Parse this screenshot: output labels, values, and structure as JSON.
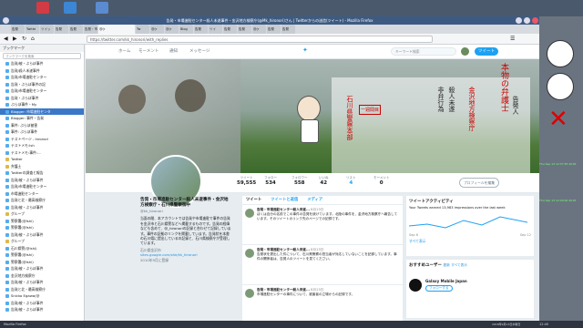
{
  "window": {
    "title": "告発・市場進駐センター殺人未遂事件・金沢地方検察庁(@Mk_hironori)さん | Twitterからの送信(ツイート) - Mozilla Firefox"
  },
  "tabs": [
    "告発",
    "Twitte",
    "ツイッ",
    "告発",
    "告発",
    "告発・市場進駐",
    "@(r",
    "Tw",
    "@(r",
    "@(r",
    "Blog",
    "告発",
    "ツイ",
    "告発",
    "告発",
    "@(r",
    "告発",
    "告発"
  ],
  "url": "https://twitter.com/kk_hironori/with_replies",
  "sidebar": {
    "title": "ブックマーク",
    "search_placeholder": "ブックマークを検索",
    "items": [
      {
        "label": "告発/被・ぶらぼ事件",
        "type": "link",
        "sel": false
      },
      {
        "label": "告発/殺人未遂事件",
        "type": "link",
        "sel": false
      },
      {
        "label": "告発/市場進駐センター",
        "type": "link",
        "sel": false
      },
      {
        "label": "告発・ぶらぼ事件の記",
        "type": "link",
        "sel": false
      },
      {
        "label": "告発/市場進駐センター",
        "type": "link",
        "sel": false
      },
      {
        "label": "告発・ぶらぼ事件",
        "type": "link",
        "sel": false
      },
      {
        "label": "ぶらぼ事件・My",
        "type": "link",
        "sel": false
      },
      {
        "label": "Blogger: 市場進駐センタ",
        "type": "link",
        "sel": true
      },
      {
        "label": "Blogger: 事件・告発",
        "type": "link",
        "sel": false
      },
      {
        "label": "事件: ぶらぼ被害",
        "type": "link",
        "sel": false
      },
      {
        "label": "事件: ぶらぼ事件",
        "type": "link",
        "sel": false
      },
      {
        "label": "テストページ - hironori",
        "type": "link",
        "sel": false
      },
      {
        "label": "テストメモ:Ish",
        "type": "link",
        "sel": false
      },
      {
        "label": "テストメモ:事件:...",
        "type": "link",
        "sel": false
      },
      {
        "label": "Twitter",
        "type": "folder",
        "sel": false
      },
      {
        "label": "弁護士",
        "type": "folder",
        "sel": false
      },
      {
        "label": "Twitterの調査と報告",
        "type": "link",
        "sel": false
      },
      {
        "label": "告発/被・ぶらぼ事件",
        "type": "link",
        "sel": false
      },
      {
        "label": "告発/市場進駐センター",
        "type": "link",
        "sel": false
      },
      {
        "label": "市場進駐センター",
        "type": "link",
        "sel": false
      },
      {
        "label": "告発と北・最高検察庁",
        "type": "link",
        "sel": false
      },
      {
        "label": "告発/被・ぶらぼ事件",
        "type": "link",
        "sel": false
      },
      {
        "label": "グループ",
        "type": "folder",
        "sel": false
      },
      {
        "label": "警察署(@Ishi)",
        "type": "link",
        "sel": false
      },
      {
        "label": "警察署(@Ishi)",
        "type": "link",
        "sel": false
      },
      {
        "label": "告発/被・ぶらぼ事件",
        "type": "link",
        "sel": false
      },
      {
        "label": "グループ",
        "type": "folder",
        "sel": false
      },
      {
        "label": "石川県警(@Ishi)",
        "type": "link",
        "sel": false
      },
      {
        "label": "警察署(@Ishi)",
        "type": "link",
        "sel": false
      },
      {
        "label": "警察署(@Ishi)",
        "type": "link",
        "sel": false
      },
      {
        "label": "告発/被・ぶらぼ事件",
        "type": "link",
        "sel": false
      },
      {
        "label": "金沢地方検察庁",
        "type": "link",
        "sel": false
      },
      {
        "label": "告発/被・ぶらぼ事件",
        "type": "link",
        "sel": false
      },
      {
        "label": "告発と北・最高検察庁",
        "type": "link",
        "sel": false
      },
      {
        "label": "Snicko Egawa(@",
        "type": "link",
        "sel": false
      },
      {
        "label": "告発/被・ぶらぼ事件",
        "type": "link",
        "sel": false
      },
      {
        "label": "告発/被・ぶらぼ事件",
        "type": "link",
        "sel": false
      }
    ]
  },
  "twitter_nav": {
    "home": "ホーム",
    "moments": "モーメント",
    "notifications": "通知",
    "messages": "メッセージ",
    "search_placeholder": "キーワード検索",
    "tweet_button": "ツイート"
  },
  "banner": {
    "right_title": "本物の弁護士",
    "col1": "金沢地方検察庁",
    "col2": "石川県警察本部",
    "col3": "告発人",
    "stamp": "一週間目",
    "sub": "殺人未遂",
    "sub2": "非弁行為"
  },
  "profile": {
    "name": "告発・市場進駐センター殺人未遂事件・金沢地方検察庁・石川県警察御中",
    "handle": "@kk_hironori",
    "stats": [
      {
        "label": "ツイート",
        "value": "59,555"
      },
      {
        "label": "フォロー",
        "value": "534"
      },
      {
        "label": "フォロワー",
        "value": "558"
      },
      {
        "label": "いいね",
        "value": "42"
      },
      {
        "label": "リスト",
        "value": "4"
      },
      {
        "label": "モーメント",
        "value": "0"
      }
    ],
    "edit_button": "プロフィールを編集",
    "bio": "当面の間、本アカウントでは告発や市場進駐で事件の告発を金沢市と石川県警などへ掲載するものです。告発の経緯なども含めて、@_hironoriの記録と合わせて記録しています。事件の証拠のリンクを掲載しています。告発状を本書の石川県に提出しているの記録と、石川県検察庁が受理しています。",
    "location": "石川県金沢市",
    "link": "sites.google.com/site/kk_hironori",
    "joined": "2010年9月に登録"
  },
  "timeline": {
    "tabs": [
      "ツイート",
      "ツイートと返信",
      "メディア"
    ],
    "tweets": [
      {
        "name": "告発・市場進駐センター殺人未遂...",
        "time": "8月13日",
        "text": "ぼくは自分の名前でこの事件の告発を続けています。北陸の事件を、金沢地方検察庁へ報告しています。そのツイートのリンク先のページでの記録です。"
      },
      {
        "name": "告発・市場進駐センター殺人未遂...",
        "time": "8月13日",
        "text": "告発状を提出した件について、石川県警察の担当者が対応していないことを記録しています。事件の関係者は、告発人のツイートを見てください。"
      },
      {
        "name": "告発・市場進駐センター殺人未遂...",
        "time": "8月13日",
        "text": "市場進駐センターの事件について、被害者の立場からの記録です。"
      }
    ]
  },
  "activity": {
    "title": "ツイートアクティビティ",
    "text": "Your Tweets earned 13,983 impressions over the last week",
    "start": "Sep 6",
    "end": "Sep 12",
    "button": "すべて表示"
  },
  "recommend": {
    "title": "おすすめユーザー",
    "refresh": "更新",
    "all": "すべて表示",
    "items": [
      {
        "name": "Galaxy Mobile Japan",
        "follow": "フォローする"
      }
    ]
  },
  "taskbar": {
    "time": "12:40",
    "date": "2018年9月13日木曜日",
    "app": "Mozilla Firefox"
  },
  "right_panel": {
    "t1": "Thu Sep 13 12:37:55 2018",
    "t2": "Thu Sep 13 12:40:00 2018"
  },
  "colors": {
    "twitter_blue": "#1da1f2",
    "titlebar": "#3d5b82",
    "selected": "#3a77c8"
  }
}
